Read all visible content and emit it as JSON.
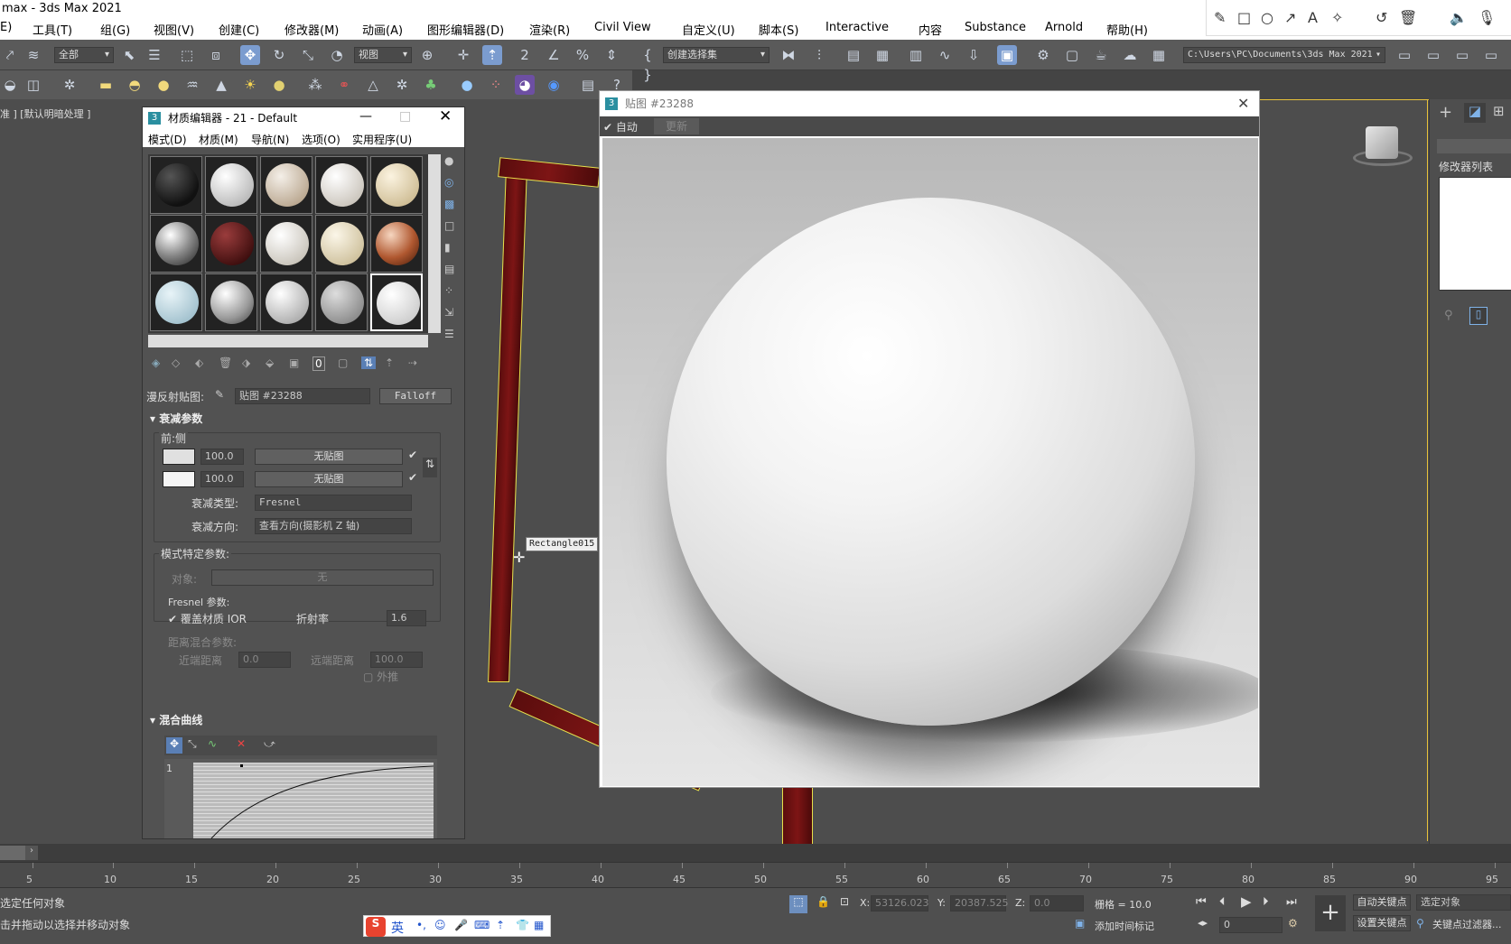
{
  "app": {
    "title": "max - 3ds Max 2021"
  },
  "menu": [
    "E)",
    "工具(T)",
    "组(G)",
    "视图(V)",
    "创建(C)",
    "修改器(M)",
    "动画(A)",
    "图形编辑器(D)",
    "渲染(R)",
    "Civil View",
    "自定义(U)",
    "脚本(S)",
    "Interactive",
    "内容",
    "Substance",
    "Arnold",
    "帮助(H)"
  ],
  "toolbar": {
    "selection_filter": "全部",
    "reference_coord": "视图",
    "named_selection": "创建选择集",
    "project_path": "C:\\Users\\PC\\Documents\\3ds Max 2021"
  },
  "viewport": {
    "label": "准 ] [默认明暗处理 ]",
    "tooltip": "Rectangle015"
  },
  "material_editor": {
    "title": "材质编辑器 - 21 - Default",
    "menu": [
      "模式(D)",
      "材质(M)",
      "导航(N)",
      "选项(O)",
      "实用程序(U)"
    ],
    "diffuse_label": "漫反射贴图:",
    "map_name": "贴图 #23288",
    "map_type": "Falloff",
    "falloff_section": "衰减参数",
    "front_side": "前:侧",
    "rows": [
      {
        "color": "#e0e0e0",
        "value": "100.0",
        "map": "无贴图"
      },
      {
        "color": "#f5f5f5",
        "value": "100.0",
        "map": "无贴图"
      }
    ],
    "falloff_type_label": "衰减类型:",
    "falloff_type": "Fresnel",
    "falloff_dir_label": "衰减方向:",
    "falloff_dir": "查看方向(摄影机 Z 轴)",
    "mode_params": "模式特定参数:",
    "object_label": "对象:",
    "object_value": "无",
    "fresnel_params": "Fresnel 参数:",
    "override_ior": "覆盖材质 IOR",
    "ior_label": "折射率",
    "ior_value": "1.6",
    "distance_blend": "距离混合参数:",
    "near_label": "近端距离",
    "near_value": "0.0",
    "far_label": "远端距离",
    "far_value": "100.0",
    "extrapolate": "外推",
    "mix_curve": "混合曲线",
    "curve_row": "1"
  },
  "map_window": {
    "title": "贴图 #23288",
    "auto": "自动",
    "update": "更新"
  },
  "command_panel": {
    "modifier_list": "修改器列表"
  },
  "timeline": {
    "ticks": [
      "5",
      "10",
      "15",
      "20",
      "25",
      "30",
      "35",
      "40",
      "45",
      "50",
      "55",
      "60",
      "65",
      "70",
      "75",
      "80",
      "85",
      "90",
      "95"
    ]
  },
  "status": {
    "line1": "选定任何对象",
    "line2": "击并拖动以选择并移动对象",
    "x_label": "X:",
    "x_value": "53126.023",
    "y_label": "Y:",
    "y_value": "20387.525",
    "z_label": "Z:",
    "z_value": "0.0",
    "grid": "栅格 = 10.0",
    "add_time_tag": "添加时间标记",
    "auto_key": "自动关键点",
    "set_key": "设置关键点",
    "selected_object": "选定对象",
    "key_filters": "关键点过滤器...",
    "frame": "0",
    "ime": "英"
  }
}
